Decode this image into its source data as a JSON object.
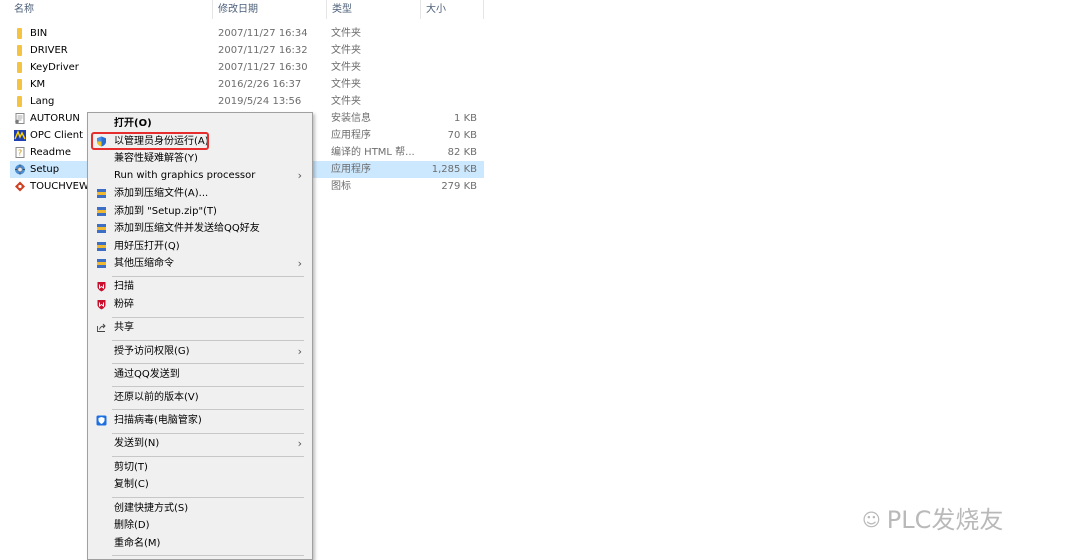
{
  "columns": {
    "name": "名称",
    "date": "修改日期",
    "type": "类型",
    "size": "大小"
  },
  "files": [
    {
      "name": "BIN",
      "date": "2007/11/27 16:34",
      "type": "文件夹",
      "size": "",
      "icon": "folder-icon"
    },
    {
      "name": "DRIVER",
      "date": "2007/11/27 16:32",
      "type": "文件夹",
      "size": "",
      "icon": "folder-icon"
    },
    {
      "name": "KeyDriver",
      "date": "2007/11/27 16:30",
      "type": "文件夹",
      "size": "",
      "icon": "folder-icon"
    },
    {
      "name": "KM",
      "date": "2016/2/26 16:37",
      "type": "文件夹",
      "size": "",
      "icon": "folder-icon"
    },
    {
      "name": "Lang",
      "date": "2019/5/24 13:56",
      "type": "文件夹",
      "size": "",
      "icon": "folder-icon"
    },
    {
      "name": "AUTORUN",
      "date": "",
      "type": "安装信息",
      "size": "1 KB",
      "icon": "setup-info-icon"
    },
    {
      "name": "OPC Client",
      "date": "",
      "type": "应用程序",
      "size": "70 KB",
      "icon": "opc-app-icon"
    },
    {
      "name": "Readme",
      "date": "",
      "type": "编译的 HTML 帮...",
      "size": "82 KB",
      "icon": "help-file-icon"
    },
    {
      "name": "Setup",
      "date": "",
      "type": "应用程序",
      "size": "1,285 KB",
      "icon": "setup-app-icon"
    },
    {
      "name": "TOUCHVEW",
      "date": "",
      "type": "图标",
      "size": "279 KB",
      "icon": "ico-file-icon"
    }
  ],
  "menu": {
    "open": "打开(O)",
    "run_as_admin": "以管理员身份运行(A)",
    "compat": "兼容性疑难解答(Y)",
    "gpu": "Run with graphics processor",
    "add_archive": "添加到压缩文件(A)...",
    "add_zip": "添加到 \"Setup.zip\"(T)",
    "add_send_qq": "添加到压缩文件并发送给QQ好友",
    "open_haozip": "用好压打开(Q)",
    "other_compress": "其他压缩命令",
    "scan": "扫描",
    "shred": "粉碎",
    "share": "共享",
    "grant_access": "授予访问权限(G)",
    "send_qq": "通过QQ发送到",
    "restore": "还原以前的版本(V)",
    "virus_scan": "扫描病毒(电脑管家)",
    "send_to": "发送到(N)",
    "cut": "剪切(T)",
    "copy": "复制(C)",
    "shortcut": "创建快捷方式(S)",
    "delete": "删除(D)",
    "rename": "重命名(M)"
  },
  "watermark": "PLC发烧友",
  "colors": {
    "selection": "#cce8ff",
    "highlight_box": "#e62e2e",
    "folder": "#f5c342",
    "menu_bg": "#f0f0f0"
  }
}
